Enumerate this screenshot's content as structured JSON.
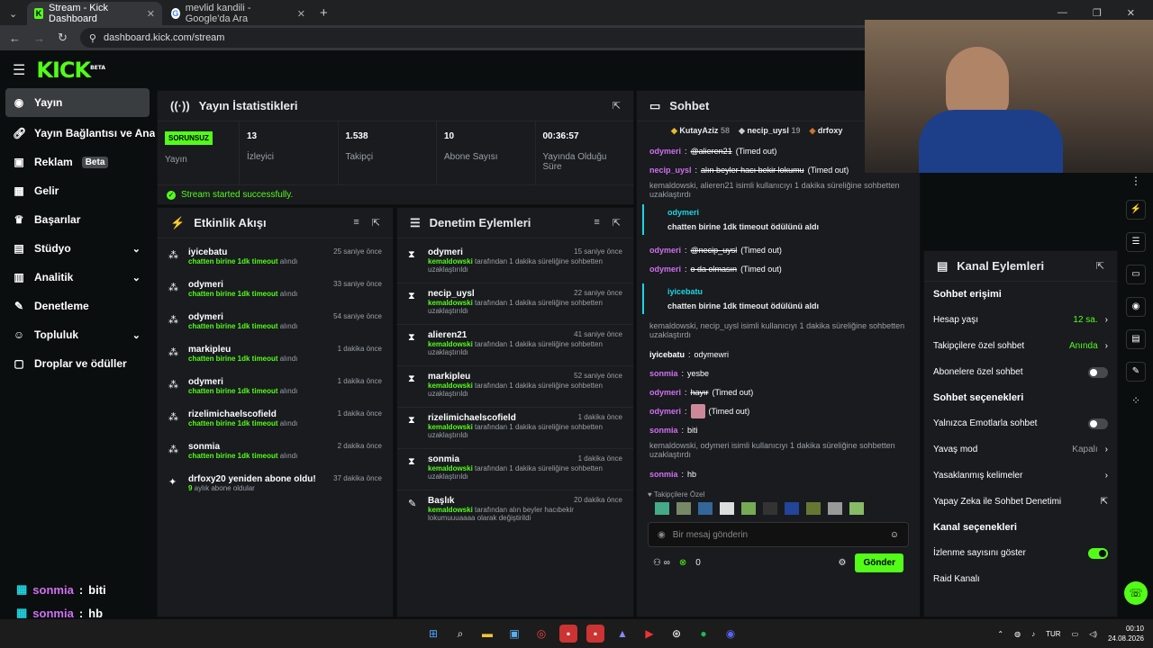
{
  "browser": {
    "tabs": [
      {
        "title": "Stream - Kick Dashboard",
        "favicon": "K"
      },
      {
        "title": "mevlid kandili - Google'da Ara",
        "favicon": "G"
      }
    ],
    "url": "dashboard.kick.com/stream"
  },
  "kick": {
    "logo": "KICK",
    "logo_badge": "BETA"
  },
  "sidebar": {
    "items": [
      {
        "label": "Yayın",
        "icon": "live-icon"
      },
      {
        "label": "Yayın Bağlantısı ve Anahtarı",
        "icon": "link-icon"
      },
      {
        "label": "Reklam",
        "icon": "ad-icon",
        "badge": "Beta"
      },
      {
        "label": "Gelir",
        "icon": "revenue-icon"
      },
      {
        "label": "Başarılar",
        "icon": "trophy-icon"
      },
      {
        "label": "Stüdyo",
        "icon": "studio-icon",
        "chevron": true
      },
      {
        "label": "Analitik",
        "icon": "analytics-icon",
        "chevron": true
      },
      {
        "label": "Denetleme",
        "icon": "moderation-icon"
      },
      {
        "label": "Topluluk",
        "icon": "community-icon",
        "chevron": true
      },
      {
        "label": "Droplar ve ödüller",
        "icon": "drops-icon"
      }
    ]
  },
  "stats": {
    "title": "Yayın İstatistikleri",
    "status_badge": "SORUNSUZ",
    "status_label": "Yayın",
    "items": [
      {
        "value": "13",
        "label": "İzleyici"
      },
      {
        "value": "1.538",
        "label": "Takipçi"
      },
      {
        "value": "10",
        "label": "Abone Sayısı"
      },
      {
        "value": "00:36:57",
        "label": "Yayında Olduğu Süre"
      }
    ],
    "success": "Stream started successfully."
  },
  "activity": {
    "title": "Etkinlik Akışı",
    "items": [
      {
        "name": "iyicebatu",
        "action": "chatten birine 1dk timeout",
        "suffix": " alındı",
        "time": "25 saniye önce"
      },
      {
        "name": "odymeri",
        "action": "chatten birine 1dk timeout",
        "suffix": " alındı",
        "time": "33 saniye önce"
      },
      {
        "name": "odymeri",
        "action": "chatten birine 1dk timeout",
        "suffix": " alındı",
        "time": "54 saniye önce"
      },
      {
        "name": "markipleu",
        "action": "chatten birine 1dk timeout",
        "suffix": " alındı",
        "time": "1 dakika önce"
      },
      {
        "name": "odymeri",
        "action": "chatten birine 1dk timeout",
        "suffix": " alındı",
        "time": "1 dakika önce"
      },
      {
        "name": "rizelimichaelscofield",
        "action": "chatten birine 1dk timeout",
        "suffix": " alındı",
        "time": "1 dakika önce"
      },
      {
        "name": "sonmia",
        "action": "chatten birine 1dk timeout",
        "suffix": " alındı",
        "time": "2 dakika önce"
      },
      {
        "name": "drfoxy20 yeniden abone oldu!",
        "action": "9",
        "suffix": " aylık abone oldular",
        "time": "37 dakika önce"
      }
    ]
  },
  "moderation": {
    "title": "Denetim Eylemleri",
    "items": [
      {
        "name": "odymeri",
        "by": "kemaldowski",
        "text": " tarafından 1 dakika süreliğine sohbetten uzaklaştırıldı",
        "time": "15 saniye önce"
      },
      {
        "name": "necip_uysl",
        "by": "kemaldowski",
        "text": " tarafından 1 dakika süreliğine sohbetten uzaklaştırıldı",
        "time": "22 saniye önce"
      },
      {
        "name": "alieren21",
        "by": "kemaldowski",
        "text": " tarafından 1 dakika süreliğine sohbetten uzaklaştırıldı",
        "time": "41 saniye önce"
      },
      {
        "name": "markipleu",
        "by": "kemaldowski",
        "text": " tarafından 1 dakika süreliğine sohbetten uzaklaştırıldı",
        "time": "52 saniye önce"
      },
      {
        "name": "rizelimichaelscofield",
        "by": "kemaldowski",
        "text": " tarafından 1 dakika süreliğine sohbetten uzaklaştırıldı",
        "time": "1 dakika önce"
      },
      {
        "name": "sonmia",
        "by": "kemaldowski",
        "text": " tarafından 1 dakika süreliğine sohbetten uzaklaştırıldı",
        "time": "1 dakika önce"
      },
      {
        "name": "Başlık",
        "by": "kemaldowski",
        "text": " tarafından alın beyler hacıbekir lokumuuuaaaa olarak değiştirildi",
        "time": "20 dakika önce"
      }
    ]
  },
  "chat": {
    "title": "Sohbet",
    "top": [
      {
        "name": "KutayAziz",
        "n": "58"
      },
      {
        "name": "necip_uysl",
        "n": "19"
      },
      {
        "name": "drfoxy",
        "n": ""
      }
    ],
    "l1_user": "odymeri",
    "l1_msg": "@alieren21",
    "l1_tag": "(Timed out)",
    "l2_user": "necip_uysl",
    "l2_msg": "alın beyler hacı bekir lokumu",
    "l2_tag": "(Timed out)",
    "sys1": "kemaldowski, alieren21 isimli kullanıcıyı 1 dakika süreliğine sohbetten uzaklaştırdı",
    "r1_user": "odymeri",
    "r1_text": "chatten birine 1dk timeout ödülünü aldı",
    "l3_user": "odymeri",
    "l3_msg": "@necip_uysl",
    "l3_tag": "(Timed out)",
    "l4_user": "odymeri",
    "l4_msg": "o da olmasın",
    "l4_tag": "(Timed out)",
    "r2_user": "iyicebatu",
    "r2_text": "chatten birine 1dk timeout ödülünü aldı",
    "sys2": "kemaldowski, necip_uysl isimli kullanıcıyı 1 dakika süreliğine sohbetten uzaklaştırdı",
    "l5_user": "iyicebatu",
    "l5_msg": "odymewri",
    "l6_user": "sonmia",
    "l6_msg": "yesbe",
    "l7_user": "odymeri",
    "l7_msg": "hayır",
    "l7_tag": "(Timed out)",
    "l8_user": "odymeri",
    "l8_tag": "(Timed out)",
    "l9_user": "sonmia",
    "l9_msg": "biti",
    "sys3": "kemaldowski, odymeri isimli kullanıcıyı 1 dakika süreliğine sohbetten uzaklaştırdı",
    "l10_user": "sonmia",
    "l10_msg": "hb",
    "followers_only": "Takipçilere Özel",
    "placeholder": "Bir mesaj gönderin",
    "points": "0",
    "send": "Gönder"
  },
  "channel": {
    "title": "Kanal Eylemleri",
    "access": "Sohbet erişimi",
    "account_age": "Hesap yaşı",
    "account_age_val": "12 sa.",
    "followers_chat": "Takipçilere özel sohbet",
    "followers_chat_val": "Anında",
    "subs_chat": "Abonelere özel sohbet",
    "options": "Sohbet seçenekleri",
    "emote_only": "Yalnızca Emotlarla sohbet",
    "slow": "Yavaş mod",
    "slow_val": "Kapalı",
    "banned": "Yasaklanmış kelimeler",
    "ai": "Yapay Zeka ile Sohbet Denetimi",
    "channel_opts": "Kanal seçenekleri",
    "show_views": "İzlenme sayısını göster",
    "raid": "Raid Kanalı"
  },
  "overlay": [
    {
      "user": "sonmia",
      "msg": "biti"
    },
    {
      "user": "sonmia",
      "msg": "hb"
    }
  ],
  "taskbar": {
    "lang": "TUR",
    "time": "00:10",
    "date": "24.08.2026"
  }
}
